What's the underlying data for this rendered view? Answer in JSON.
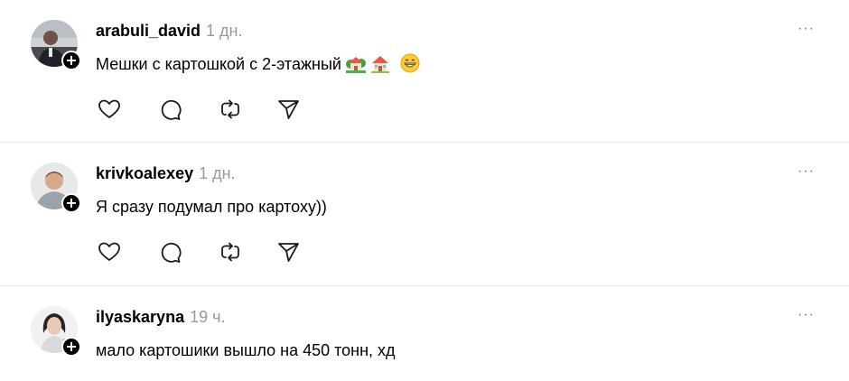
{
  "posts": [
    {
      "username": "arabuli_david",
      "time": "1 дн.",
      "text": "Мешки с картошкой с 2-этажный",
      "emoji": [
        "house-with-garden-emoji",
        "house-emoji",
        "grinning-face-emoji"
      ]
    },
    {
      "username": "krivkoalexey",
      "time": "1 дн.",
      "text": "Я сразу подумал про картоху))"
    },
    {
      "username": "ilyaskaryna",
      "time": "19 ч.",
      "text": "мало картошики вышло на 450 тонн, хд"
    }
  ],
  "more_label": "···",
  "follow_label": "+",
  "colors": {
    "text": "#000000",
    "muted": "#999999",
    "divider": "#e3e3e3",
    "icon": "#1a1a1a"
  }
}
